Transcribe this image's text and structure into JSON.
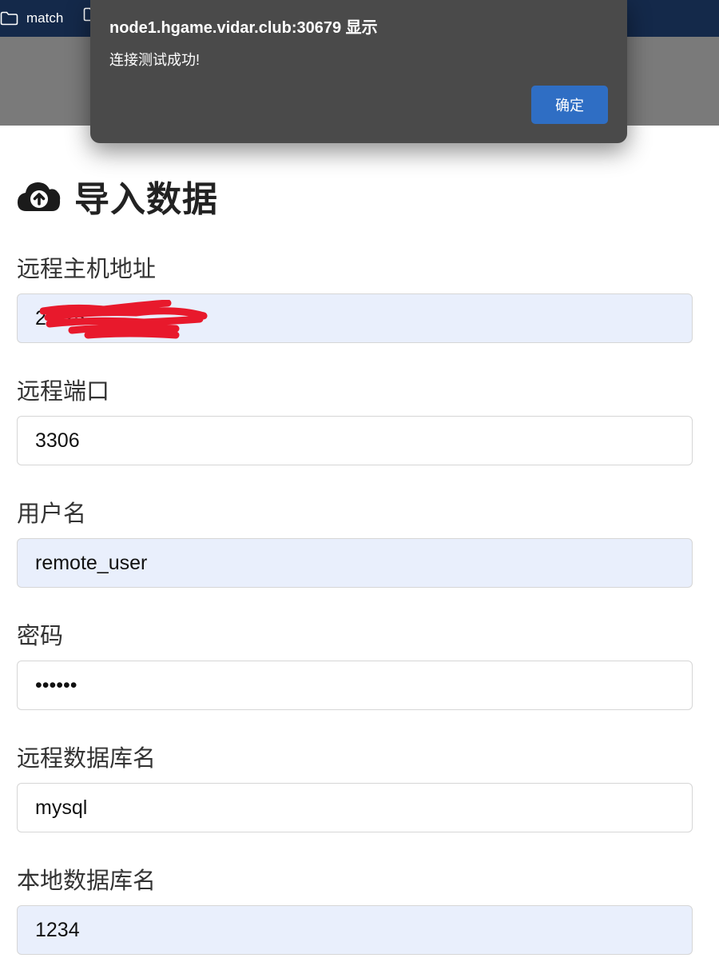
{
  "bookmarks_bar": {
    "items": [
      {
        "label": "match",
        "icon": "folder-icon"
      },
      {
        "label": "",
        "icon": "folder-icon"
      }
    ]
  },
  "page": {
    "title": "导入数据",
    "title_icon": "cloud-upload-icon"
  },
  "form": {
    "fields": [
      {
        "label": "远程主机地址",
        "value": "27.25",
        "autofilled": true,
        "redacted": true
      },
      {
        "label": "远程端口",
        "value": "3306",
        "autofilled": false
      },
      {
        "label": "用户名",
        "value": "remote_user",
        "autofilled": true
      },
      {
        "label": "密码",
        "value": "••••••",
        "type": "password",
        "autofilled": false
      },
      {
        "label": "远程数据库名",
        "value": "mysql",
        "autofilled": false
      },
      {
        "label": "本地数据库名",
        "value": "1234",
        "autofilled": true
      }
    ]
  },
  "alert_dialog": {
    "title": "node1.hgame.vidar.club:30679 显示",
    "message": "连接测试成功!",
    "ok_label": "确定"
  },
  "colors": {
    "bookmark_bar_bg": "#14294a",
    "dialog_bg": "#4a4a4a",
    "dialog_button": "#2f6ec4",
    "autofill_bg": "#e9effc",
    "redaction": "#e8192c"
  }
}
